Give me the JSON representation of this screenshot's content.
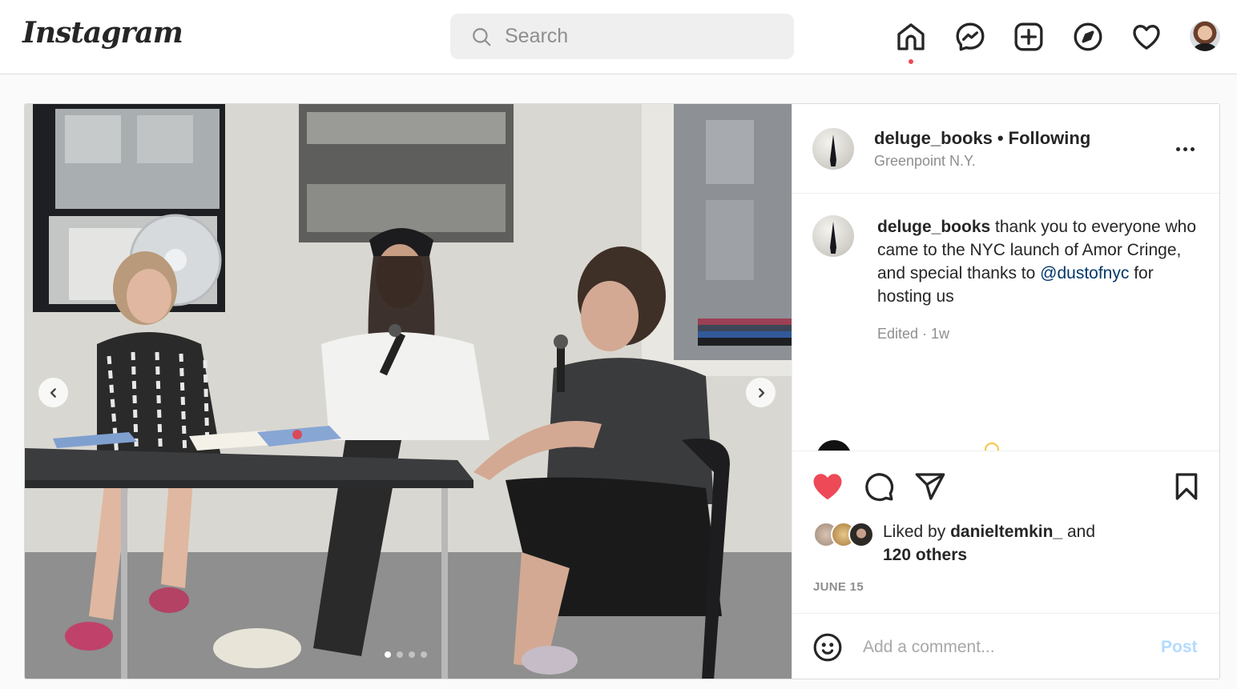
{
  "app": {
    "logo_text": "Instagram"
  },
  "search": {
    "placeholder": "Search",
    "value": ""
  },
  "nav": {
    "items": [
      {
        "name": "home",
        "icon": "home-icon",
        "active": true
      },
      {
        "name": "messenger",
        "icon": "messenger-icon"
      },
      {
        "name": "new-post",
        "icon": "plus-square-icon"
      },
      {
        "name": "explore",
        "icon": "compass-icon"
      },
      {
        "name": "activity",
        "icon": "heart-icon"
      },
      {
        "name": "profile",
        "icon": "avatar"
      }
    ],
    "notification_dot_color": "#ed4956"
  },
  "post": {
    "media": {
      "type": "carousel",
      "slide_count": 4,
      "current_slide": 1,
      "description": "Three people seated at a folding table holding microphones in a white room with windows, a fan, and a poster"
    },
    "header": {
      "username": "deluge_books",
      "separator": "•",
      "follow_status": "Following",
      "location": "Greenpoint N.Y."
    },
    "caption": {
      "username": "deluge_books",
      "text_before_mention": " thank you to everyone who came to the NYC launch of Amor Cringe, and special thanks to ",
      "mention": "@dustofnyc",
      "text_after_mention": " for hosting us",
      "meta": "Edited · 1w"
    },
    "actions": {
      "liked": true,
      "like_color": "#ed4956"
    },
    "likes": {
      "prefix": "Liked by ",
      "first_user": "danieltemkin_",
      "joiner": " and",
      "others": "120 others"
    },
    "date": "JUNE 15",
    "comment_box": {
      "placeholder": "Add a comment...",
      "value": "",
      "post_label": "Post",
      "post_color": "#b3dbff"
    }
  },
  "colors": {
    "link": "#00376b",
    "secondary_text": "#8e8e8e",
    "primary_text": "#262626"
  }
}
